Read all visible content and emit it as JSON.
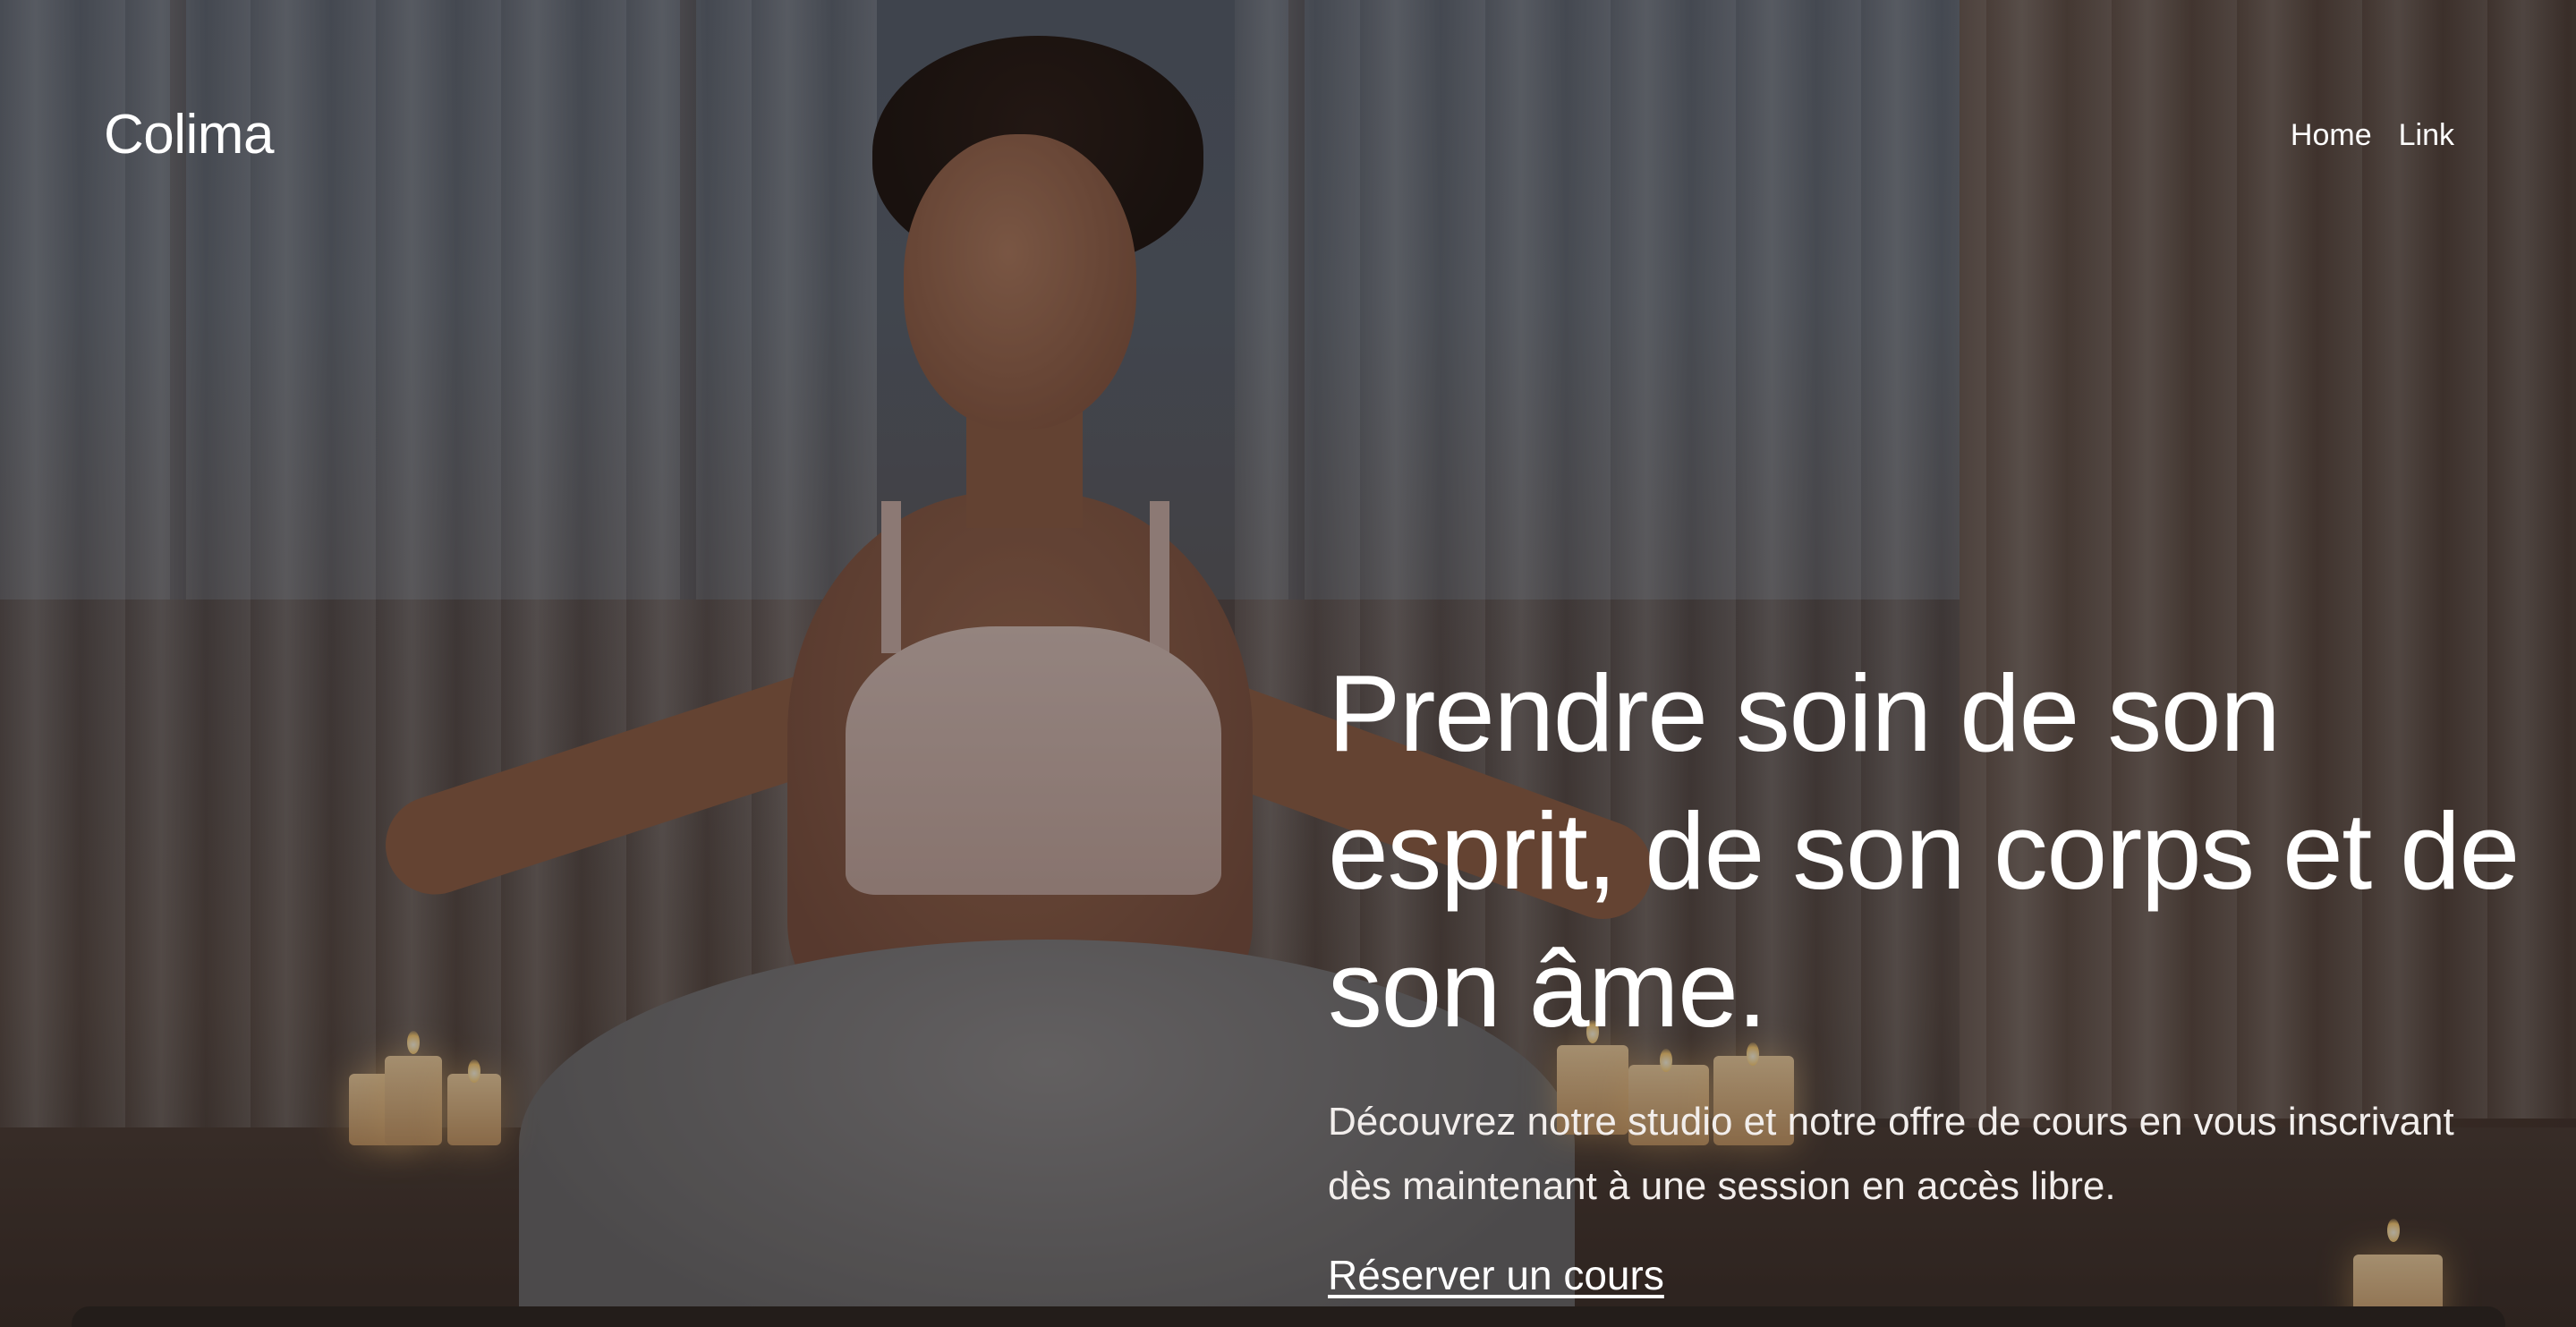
{
  "header": {
    "brand": "Colima",
    "nav": [
      {
        "label": "Home"
      },
      {
        "label": "Link"
      }
    ]
  },
  "hero": {
    "title": "Prendre soin de son esprit, de son corps et de son âme.",
    "description": "Découvrez notre studio et notre offre de cours en vous inscrivant dès maintenant à une session en accès libre.",
    "cta_label": "Réserver un cours"
  },
  "background": {
    "icon": "meditating-woman-photo"
  }
}
